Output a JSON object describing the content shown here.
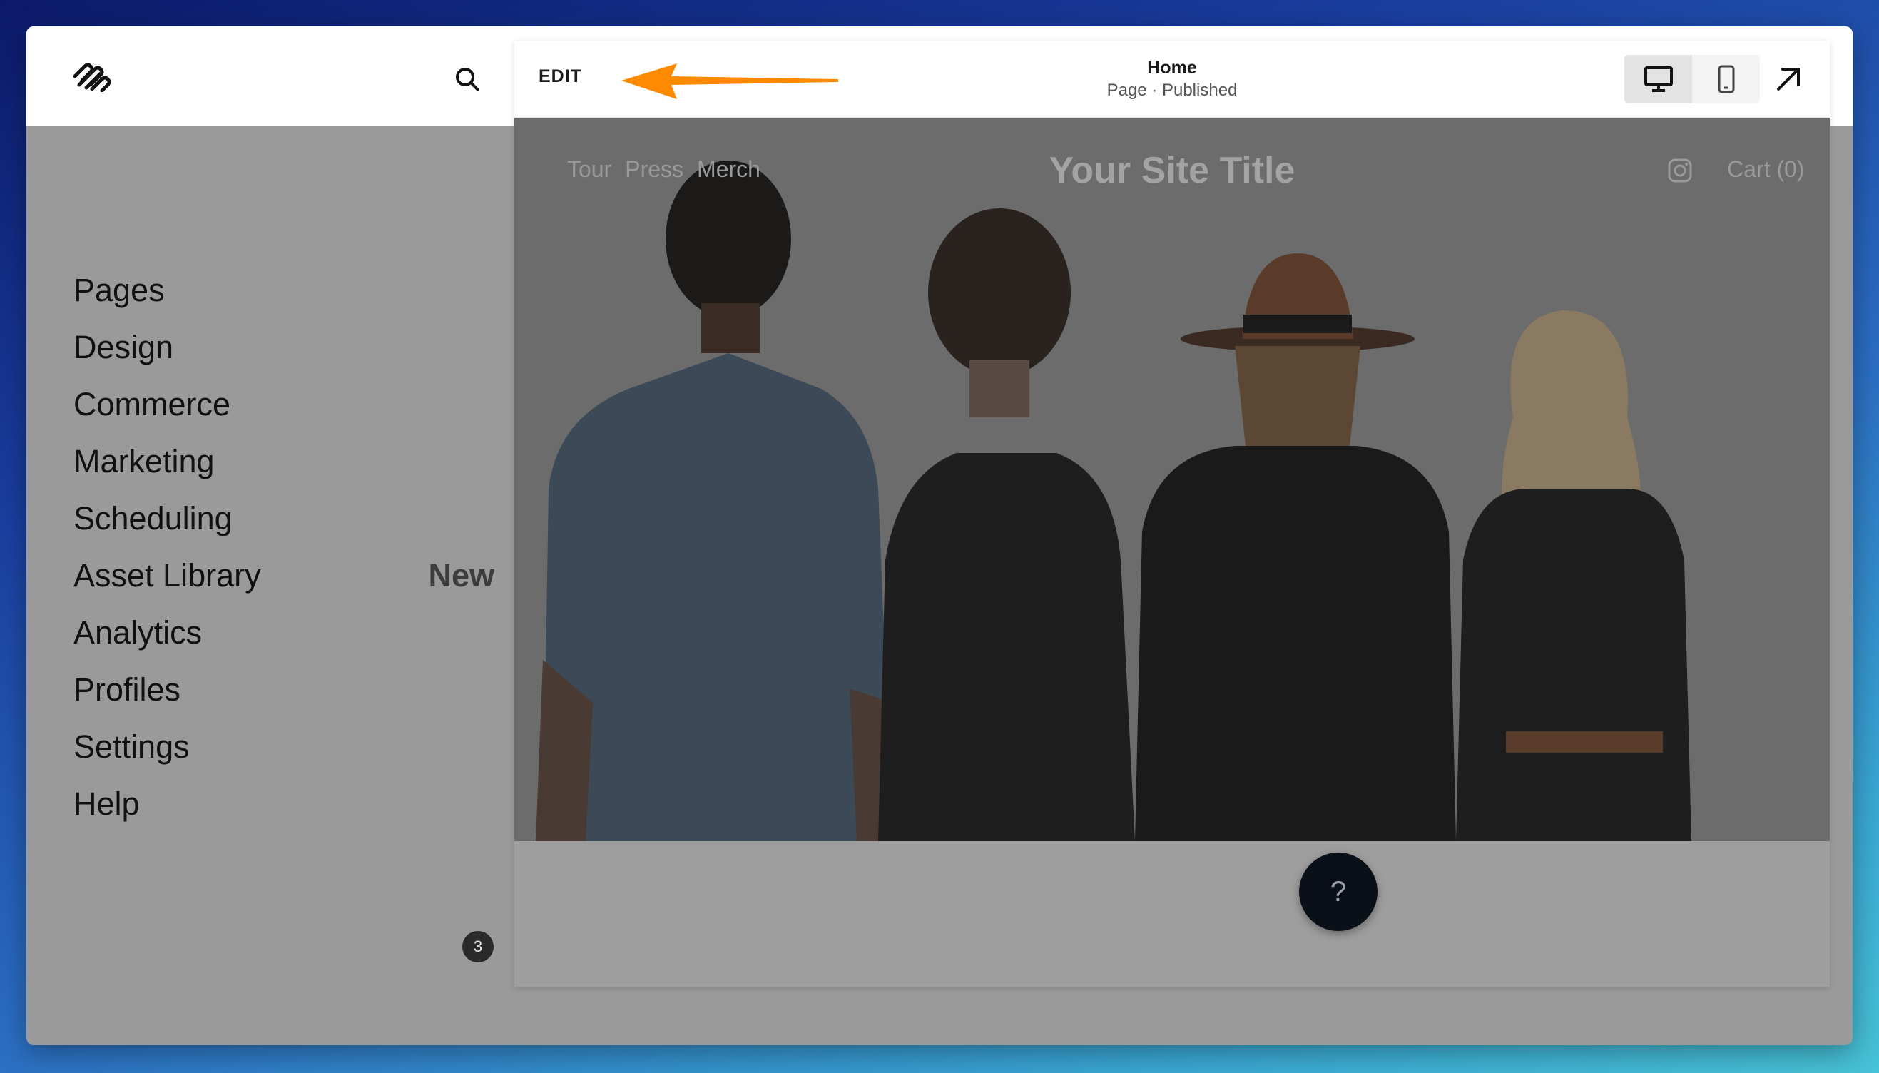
{
  "sidebar": {
    "items": [
      {
        "label": "Pages"
      },
      {
        "label": "Design"
      },
      {
        "label": "Commerce"
      },
      {
        "label": "Marketing"
      },
      {
        "label": "Scheduling"
      },
      {
        "label": "Asset Library",
        "badge": "New"
      },
      {
        "label": "Analytics"
      },
      {
        "label": "Profiles"
      },
      {
        "label": "Settings"
      },
      {
        "label": "Help"
      }
    ],
    "notification_count": "3"
  },
  "header": {
    "edit_label": "EDIT",
    "page_title": "Home",
    "page_status": "Page · Published"
  },
  "site": {
    "nav": [
      "Tour",
      "Press",
      "Merch"
    ],
    "title": "Your Site Title",
    "cart": "Cart (0)"
  },
  "help_button": "?",
  "colors": {
    "accent_arrow": "#ff8a00",
    "help_button_bg": "#0a1018"
  },
  "icons": [
    "squarespace-logo",
    "search-icon",
    "desktop-icon",
    "mobile-icon",
    "open-external-icon",
    "instagram-icon"
  ]
}
